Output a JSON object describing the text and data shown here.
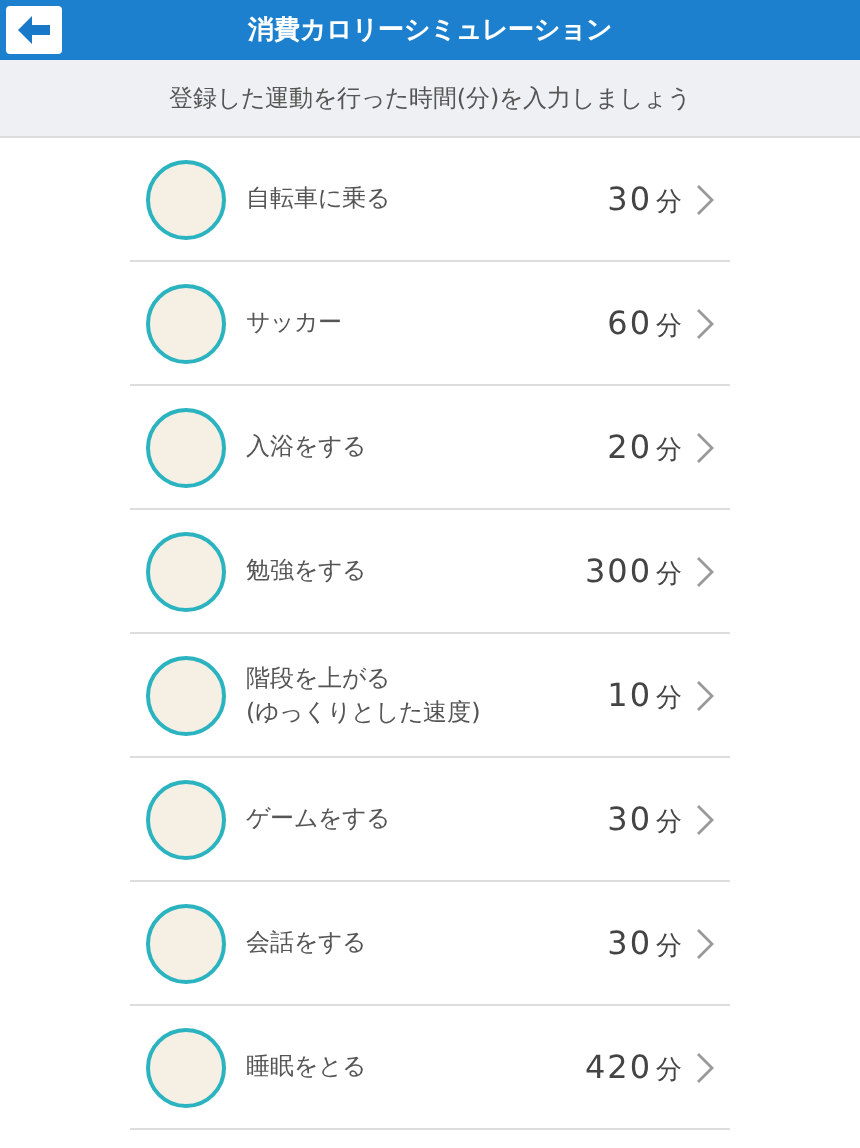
{
  "header": {
    "title": "消費カロリーシミュレーション"
  },
  "instruction": "登録した運動を行った時間(分)を入力しましょう",
  "activities": [
    {
      "name": "自転車に乗る",
      "minutes": "30",
      "unit": "分"
    },
    {
      "name": "サッカー",
      "minutes": "60",
      "unit": "分"
    },
    {
      "name": "入浴をする",
      "minutes": "20",
      "unit": "分"
    },
    {
      "name": "勉強をする",
      "minutes": "300",
      "unit": "分"
    },
    {
      "name": "階段を上がる\n(ゆっくりとした速度)",
      "minutes": "10",
      "unit": "分"
    },
    {
      "name": "ゲームをする",
      "minutes": "30",
      "unit": "分"
    },
    {
      "name": "会話をする",
      "minutes": "30",
      "unit": "分"
    },
    {
      "name": "睡眠をとる",
      "minutes": "420",
      "unit": "分"
    }
  ]
}
